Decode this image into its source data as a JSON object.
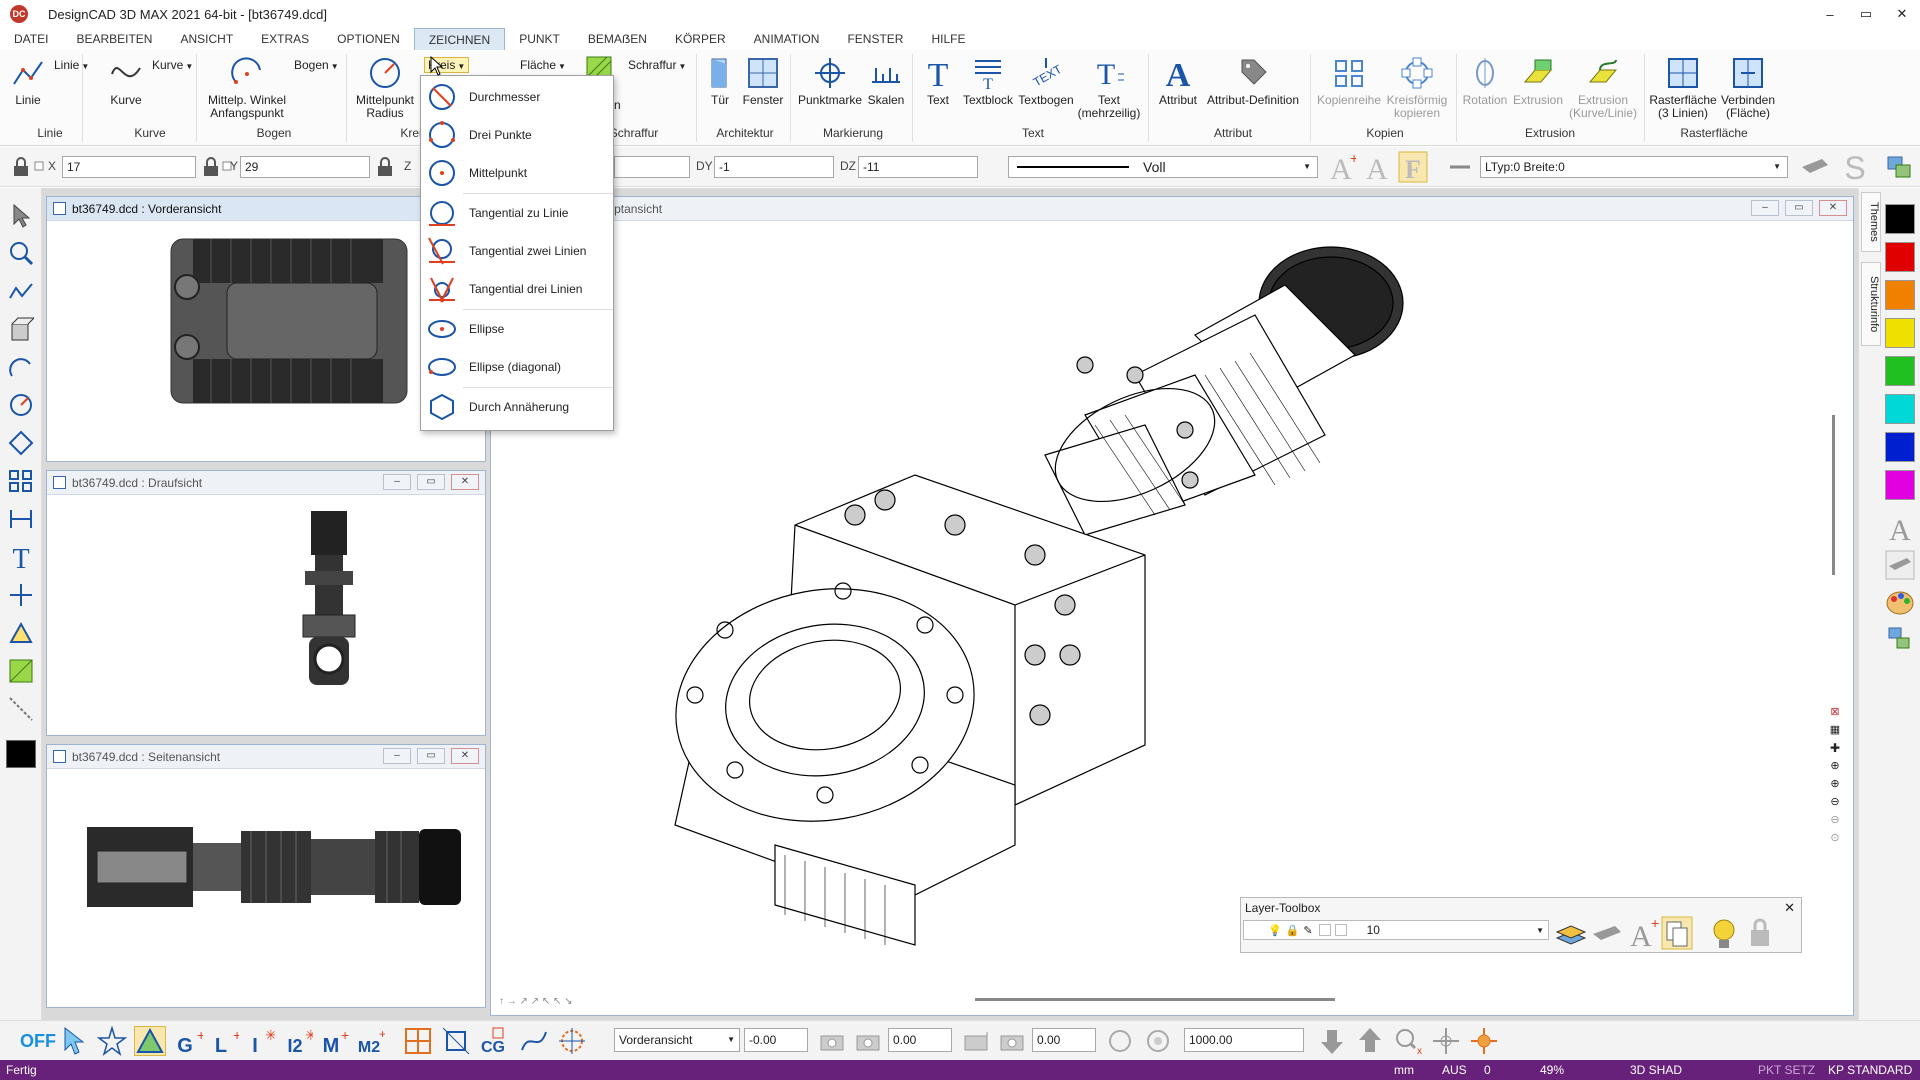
{
  "app": {
    "title": "DesignCAD 3D MAX 2021 64-bit - [bt36749.dcd]",
    "logo": "DC",
    "window_controls": [
      "–",
      "▭",
      "✕"
    ]
  },
  "menu": [
    "DATEI",
    "BEARBEITEN",
    "ANSICHT",
    "EXTRAS",
    "OPTIONEN",
    "ZEICHNEN",
    "PUNKT",
    "BEMAẞEN",
    "KÖRPER",
    "ANIMATION",
    "FENSTER",
    "HILFE"
  ],
  "menu_active": "ZEICHNEN",
  "ribbon": {
    "linie": {
      "label": "Linie",
      "dropdown": "Linie",
      "group": "Linie"
    },
    "kurve": {
      "label": "Kurve",
      "dropdown": "Kurve",
      "group": "Kurve"
    },
    "bogen": {
      "label": "Mittelp. Winkel Anfangspunkt",
      "dropdown": "Bogen",
      "group": "Bogen"
    },
    "kreis": {
      "label": "Mittelpunkt Radius",
      "dropdown": "Kreis",
      "group": "Kreis"
    },
    "flaeche": {
      "dropdown": "Fläche"
    },
    "schraffur": {
      "dropdown": "Schraffur",
      "group": "Schraffur",
      "partial": "n"
    },
    "tuer": "Tür",
    "fenster": "Fenster",
    "architektur_group": "Architektur",
    "punktmarke": "Punktmarke",
    "skalen": "Skalen",
    "markierung_group": "Markierung",
    "text": "Text",
    "textblock": "Textblock",
    "textbogen": "Textbogen",
    "text_mehrzeilig": "Text (mehrzeilig)",
    "text_group": "Text",
    "attribut": "Attribut",
    "attribut_def": "Attribut-Definition",
    "attribut_group": "Attribut",
    "kopienreihe": "Kopienreihe",
    "kreisfoermig": "Kreisförmig kopieren",
    "kopien_group": "Kopien",
    "rotation": "Rotation",
    "extrusion": "Extrusion",
    "extrusion_kurve": "Extrusion (Kurve/Linie)",
    "extrusion_group": "Extrusion",
    "rasterflaeche": "Rasterfläche (3 Linien)",
    "verbinden": "Verbinden (Fläche)",
    "rasterflaeche_group": "Rasterfläche"
  },
  "coords": {
    "x_label": "X",
    "x": "17",
    "y_label": "Y",
    "y": "29",
    "z_label": "Z",
    "dy_label": "DY",
    "dy": "-1",
    "dz_label": "DZ",
    "dz": "-11",
    "linestyle": "Voll",
    "ltyp": "LTyp:0  Breite:0"
  },
  "kreis_menu": [
    {
      "label": "Durchmesser",
      "icon": "circle-diameter-icon"
    },
    {
      "label": "Drei Punkte",
      "icon": "circle-three-points-icon"
    },
    {
      "label": "Mittelpunkt",
      "icon": "circle-center-icon"
    },
    {
      "label": "Tangential zu Linie",
      "icon": "circle-tangent-line-icon"
    },
    {
      "label": "Tangential zwei Linien",
      "icon": "circle-tangent-two-icon"
    },
    {
      "label": "Tangential drei Linien",
      "icon": "circle-tangent-three-icon"
    },
    {
      "label": "Ellipse",
      "icon": "ellipse-icon"
    },
    {
      "label": "Ellipse (diagonal)",
      "icon": "ellipse-diagonal-icon"
    },
    {
      "label": "Durch Annäherung",
      "icon": "circle-approx-icon"
    }
  ],
  "views": {
    "front": "bt36749.dcd : Vorderansicht",
    "top": "bt36749.dcd : Draufsicht",
    "side": "bt36749.dcd : Seitenansicht",
    "main": "bt36749.dcd : Hauptansicht"
  },
  "right_tabs": [
    "Themes",
    "Strukturinfo"
  ],
  "palette": [
    "#000000",
    "#e00000",
    "#f08000",
    "#f0e000",
    "#20c020",
    "#00d8d8",
    "#0020d0",
    "#e000e0"
  ],
  "layer_toolbox": {
    "title": "Layer-Toolbox",
    "layer": "10"
  },
  "bottom": {
    "off": "OFF",
    "view": "Vorderansicht",
    "v1": "-0.00",
    "v2": "0.00",
    "v3": "0.00",
    "v4": "1000.00"
  },
  "status": {
    "left": "Fertig",
    "unit": "mm",
    "aus": "AUS",
    "zero": "0",
    "zoom": "49%",
    "mode": "3D SHAD",
    "pkt": "PKT SETZ",
    "kp": "KP STANDARD"
  }
}
